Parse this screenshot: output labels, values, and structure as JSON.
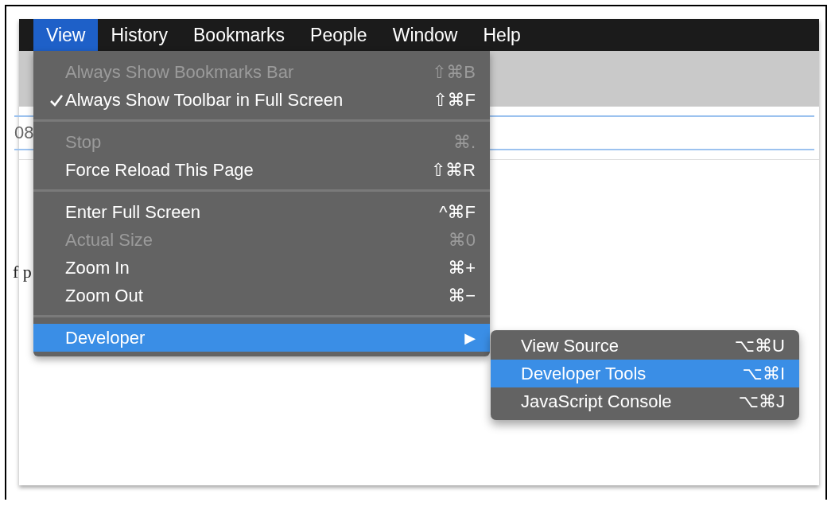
{
  "menu_bar": [
    {
      "label": "View",
      "selected": true
    },
    {
      "label": "History",
      "selected": false
    },
    {
      "label": "Bookmarks",
      "selected": false
    },
    {
      "label": "People",
      "selected": false
    },
    {
      "label": "Window",
      "selected": false
    },
    {
      "label": "Help",
      "selected": false
    }
  ],
  "address_bar": {
    "value": "08"
  },
  "page_text": "f p",
  "menu": {
    "items": [
      {
        "kind": "item",
        "label": "Always Show Bookmarks Bar",
        "shortcut": "⇧⌘B",
        "disabled": true,
        "checked": false,
        "selected": false
      },
      {
        "kind": "item",
        "label": "Always Show Toolbar in Full Screen",
        "shortcut": "⇧⌘F",
        "disabled": false,
        "checked": true,
        "selected": false
      },
      {
        "kind": "separator"
      },
      {
        "kind": "item",
        "label": "Stop",
        "shortcut": "⌘.",
        "disabled": true,
        "checked": false,
        "selected": false
      },
      {
        "kind": "item",
        "label": "Force Reload This Page",
        "shortcut": "⇧⌘R",
        "disabled": false,
        "checked": false,
        "selected": false
      },
      {
        "kind": "separator"
      },
      {
        "kind": "item",
        "label": "Enter Full Screen",
        "shortcut": "^⌘F",
        "disabled": false,
        "checked": false,
        "selected": false
      },
      {
        "kind": "item",
        "label": "Actual Size",
        "shortcut": "⌘0",
        "disabled": true,
        "checked": false,
        "selected": false
      },
      {
        "kind": "item",
        "label": "Zoom In",
        "shortcut": "⌘+",
        "disabled": false,
        "checked": false,
        "selected": false
      },
      {
        "kind": "item",
        "label": "Zoom Out",
        "shortcut": "⌘−",
        "disabled": false,
        "checked": false,
        "selected": false
      },
      {
        "kind": "separator"
      },
      {
        "kind": "submenu",
        "label": "Developer",
        "arrow": "▶",
        "disabled": false,
        "checked": false,
        "selected": true
      }
    ]
  },
  "submenu": {
    "items": [
      {
        "kind": "item",
        "label": "View Source",
        "shortcut": "⌥⌘U",
        "disabled": false,
        "checked": false,
        "selected": false
      },
      {
        "kind": "item",
        "label": "Developer Tools",
        "shortcut": "⌥⌘I",
        "disabled": false,
        "checked": false,
        "selected": true
      },
      {
        "kind": "item",
        "label": "JavaScript Console",
        "shortcut": "⌥⌘J",
        "disabled": false,
        "checked": false,
        "selected": false
      }
    ]
  }
}
